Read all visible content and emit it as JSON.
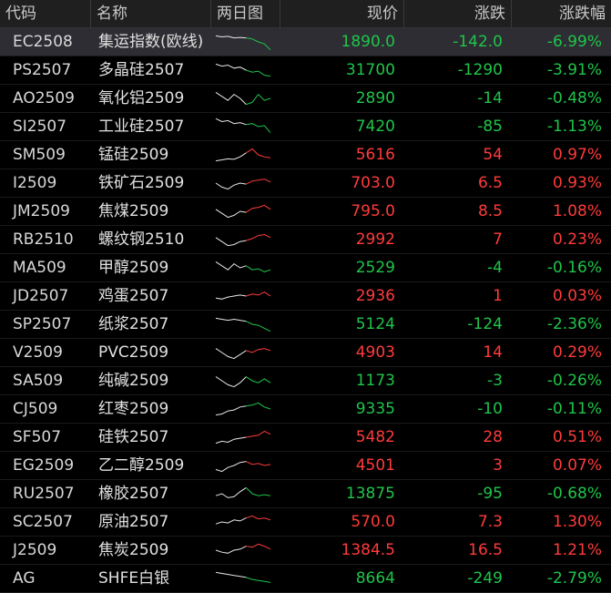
{
  "header": {
    "code": "代码",
    "name": "名称",
    "chart": "两日图",
    "price": "现价",
    "change": "涨跌",
    "pct": "涨跌幅"
  },
  "colors": {
    "up": "#ff3b3b",
    "down": "#1fc54a",
    "line": "#e8e8e8"
  },
  "rows": [
    {
      "code": "EC2508",
      "name": "集运指数(欧线)",
      "price": "1890.0",
      "change": "-142.0",
      "pct": "-6.99%",
      "dir": "down",
      "selected": true,
      "spark": [
        0.2,
        0.25,
        0.22,
        0.3,
        0.28,
        0.3,
        0.35,
        0.5,
        0.6,
        0.9
      ]
    },
    {
      "code": "PS2507",
      "name": "多晶硅2507",
      "price": "31700",
      "change": "-1290",
      "pct": "-3.91%",
      "dir": "down",
      "spark": [
        0.2,
        0.3,
        0.25,
        0.4,
        0.35,
        0.5,
        0.6,
        0.55,
        0.75,
        0.8
      ]
    },
    {
      "code": "AO2509",
      "name": "氧化铝2509",
      "price": "2890",
      "change": "-14",
      "pct": "-0.48%",
      "dir": "down",
      "spark": [
        0.2,
        0.4,
        0.6,
        0.3,
        0.5,
        0.8,
        0.7,
        0.3,
        0.6,
        0.5
      ]
    },
    {
      "code": "SI2507",
      "name": "工业硅2507",
      "price": "7420",
      "change": "-85",
      "pct": "-1.13%",
      "dir": "down",
      "spark": [
        0.1,
        0.25,
        0.2,
        0.35,
        0.3,
        0.4,
        0.35,
        0.5,
        0.45,
        0.8
      ]
    },
    {
      "code": "SM509",
      "name": "锰硅2509",
      "price": "5616",
      "change": "54",
      "pct": "0.97%",
      "dir": "up",
      "spark": [
        0.8,
        0.75,
        0.7,
        0.72,
        0.6,
        0.4,
        0.2,
        0.5,
        0.6,
        0.65
      ]
    },
    {
      "code": "I2509",
      "name": "铁矿石2509",
      "price": "703.0",
      "change": "6.5",
      "pct": "0.93%",
      "dir": "up",
      "spark": [
        0.5,
        0.7,
        0.8,
        0.6,
        0.5,
        0.55,
        0.4,
        0.35,
        0.3,
        0.45
      ]
    },
    {
      "code": "JM2509",
      "name": "焦煤2509",
      "price": "795.0",
      "change": "8.5",
      "pct": "1.08%",
      "dir": "up",
      "spark": [
        0.4,
        0.6,
        0.8,
        0.7,
        0.5,
        0.55,
        0.35,
        0.3,
        0.2,
        0.4
      ]
    },
    {
      "code": "RB2510",
      "name": "螺纹钢2510",
      "price": "2992",
      "change": "7",
      "pct": "0.23%",
      "dir": "up",
      "spark": [
        0.4,
        0.6,
        0.8,
        0.75,
        0.6,
        0.55,
        0.45,
        0.3,
        0.25,
        0.4
      ]
    },
    {
      "code": "MA509",
      "name": "甲醇2509",
      "price": "2529",
      "change": "-4",
      "pct": "-0.16%",
      "dir": "down",
      "spark": [
        0.2,
        0.4,
        0.6,
        0.3,
        0.5,
        0.4,
        0.6,
        0.55,
        0.7,
        0.6
      ]
    },
    {
      "code": "JD2507",
      "name": "鸡蛋2507",
      "price": "2936",
      "change": "1",
      "pct": "0.03%",
      "dir": "up",
      "spark": [
        0.6,
        0.65,
        0.55,
        0.5,
        0.45,
        0.5,
        0.4,
        0.45,
        0.3,
        0.5
      ]
    },
    {
      "code": "SP2507",
      "name": "纸浆2507",
      "price": "5124",
      "change": "-124",
      "pct": "-2.36%",
      "dir": "down",
      "spark": [
        0.2,
        0.25,
        0.3,
        0.25,
        0.3,
        0.35,
        0.5,
        0.55,
        0.7,
        0.85
      ]
    },
    {
      "code": "V2509",
      "name": "PVC2509",
      "price": "4903",
      "change": "14",
      "pct": "0.29%",
      "dir": "up",
      "spark": [
        0.3,
        0.5,
        0.7,
        0.8,
        0.6,
        0.4,
        0.5,
        0.35,
        0.3,
        0.4
      ]
    },
    {
      "code": "SA509",
      "name": "纯碱2509",
      "price": "1173",
      "change": "-3",
      "pct": "-0.26%",
      "dir": "down",
      "spark": [
        0.3,
        0.5,
        0.7,
        0.8,
        0.6,
        0.3,
        0.5,
        0.6,
        0.4,
        0.6
      ]
    },
    {
      "code": "CJ509",
      "name": "红枣2509",
      "price": "9335",
      "change": "-10",
      "pct": "-0.11%",
      "dir": "down",
      "spark": [
        0.8,
        0.75,
        0.6,
        0.55,
        0.4,
        0.35,
        0.3,
        0.2,
        0.4,
        0.5
      ]
    },
    {
      "code": "SF507",
      "name": "硅铁2507",
      "price": "5482",
      "change": "28",
      "pct": "0.51%",
      "dir": "up",
      "spark": [
        0.8,
        0.7,
        0.75,
        0.6,
        0.55,
        0.5,
        0.45,
        0.4,
        0.2,
        0.35
      ]
    },
    {
      "code": "EG2509",
      "name": "乙二醇2509",
      "price": "4501",
      "change": "3",
      "pct": "0.07%",
      "dir": "up",
      "spark": [
        0.7,
        0.8,
        0.6,
        0.5,
        0.35,
        0.3,
        0.45,
        0.4,
        0.5,
        0.45
      ]
    },
    {
      "code": "RU2507",
      "name": "橡胶2507",
      "price": "13875",
      "change": "-95",
      "pct": "-0.68%",
      "dir": "down",
      "spark": [
        0.6,
        0.5,
        0.7,
        0.65,
        0.4,
        0.2,
        0.5,
        0.6,
        0.55,
        0.6
      ]
    },
    {
      "code": "SC2507",
      "name": "原油2507",
      "price": "570.0",
      "change": "7.3",
      "pct": "1.30%",
      "dir": "up",
      "spark": [
        0.6,
        0.5,
        0.55,
        0.4,
        0.45,
        0.3,
        0.2,
        0.35,
        0.3,
        0.4
      ]
    },
    {
      "code": "J2509",
      "name": "焦炭2509",
      "price": "1384.5",
      "change": "16.5",
      "pct": "1.21%",
      "dir": "up",
      "spark": [
        0.5,
        0.6,
        0.65,
        0.5,
        0.45,
        0.3,
        0.35,
        0.2,
        0.3,
        0.45
      ]
    },
    {
      "code": "AG",
      "name": "SHFE白银",
      "price": "8664",
      "change": "-249",
      "pct": "-2.79%",
      "dir": "down",
      "spark": [
        0.2,
        0.25,
        0.3,
        0.35,
        0.4,
        0.45,
        0.55,
        0.6,
        0.65,
        0.7
      ]
    }
  ]
}
